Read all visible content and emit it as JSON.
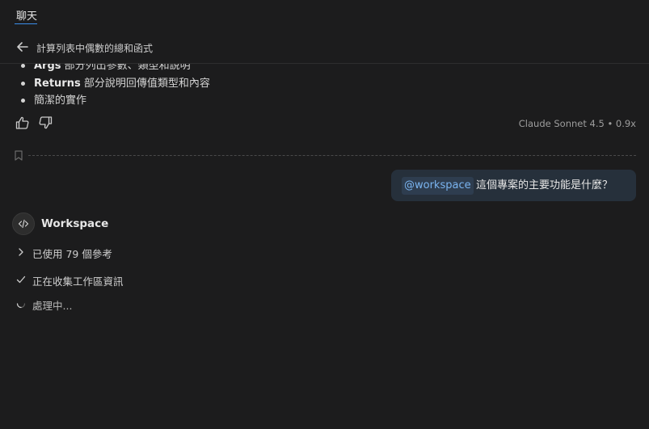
{
  "tab": {
    "label": "聊天"
  },
  "header": {
    "title": "計算列表中偶數的總和函式"
  },
  "response": {
    "bullets": [
      {
        "bold": "Args",
        "text": " 部分列出參數、類型和說明"
      },
      {
        "bold": "Returns",
        "text": " 部分說明回傳值類型和內容"
      },
      {
        "bold": "",
        "text": "簡潔的實作"
      }
    ],
    "model_info": "Claude Sonnet 4.5 • 0.9x"
  },
  "user_message": {
    "mention": "@workspace",
    "text": "這個專案的主要功能是什麼？"
  },
  "agent": {
    "name": "Workspace",
    "references": "已使用 79 個參考",
    "step_done": "正在收集工作區資訊",
    "step_progress": "處理中..."
  },
  "colors": {
    "background": "#1c1c1d",
    "accent": "#3b8eea",
    "mention_text": "#7ab4f0",
    "bubble": "#26303b"
  }
}
